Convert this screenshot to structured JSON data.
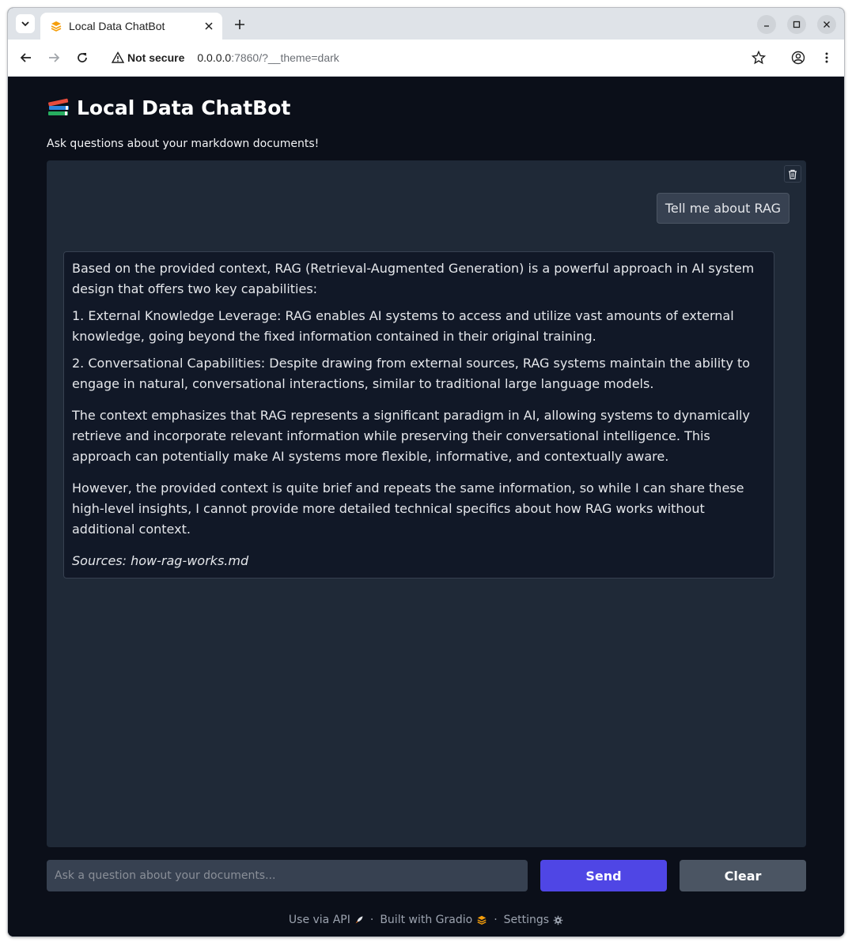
{
  "browser": {
    "tab_title": "Local Data ChatBot",
    "security_label": "Not secure",
    "url_host": "0.0.0.0",
    "url_path": ":7860/?__theme=dark"
  },
  "app": {
    "title": "Local Data ChatBot",
    "subtitle": "Ask questions about your markdown documents!"
  },
  "chat": {
    "user_message": "Tell me about RAG",
    "bot_message": {
      "intro": "Based on the provided context, RAG (Retrieval-Augmented Generation) is a powerful approach in AI system design that offers two key capabilities:",
      "item_1": "1. External Knowledge Leverage: RAG enables AI systems to access and utilize vast amounts of external knowledge, going beyond the fixed information contained in their original training.",
      "item_2": "2. Conversational Capabilities: Despite drawing from external sources, RAG systems maintain the ability to engage in natural, conversational interactions, similar to traditional large language models.",
      "para_1": "The context emphasizes that RAG represents a significant paradigm in AI, allowing systems to dynamically retrieve and incorporate relevant information while preserving their conversational intelligence. This approach can potentially make AI systems more flexible, informative, and contextually aware.",
      "para_2": "However, the provided context is quite brief and repeats the same information, so while I can share these high-level insights, I cannot provide more detailed technical specifics about how RAG works without additional context.",
      "sources": "Sources: how-rag-works.md"
    }
  },
  "input": {
    "placeholder": "Ask a question about your documents...",
    "value": ""
  },
  "buttons": {
    "send": "Send",
    "clear": "Clear"
  },
  "footer": {
    "api": "Use via API",
    "built": "Built with Gradio",
    "settings": "Settings",
    "separator": "·"
  },
  "colors": {
    "page_bg": "#0b0f19",
    "panel_bg": "#1f2937",
    "primary": "#4f46e5",
    "secondary": "#4b5563",
    "gradio_orange": "#f59e0b"
  }
}
